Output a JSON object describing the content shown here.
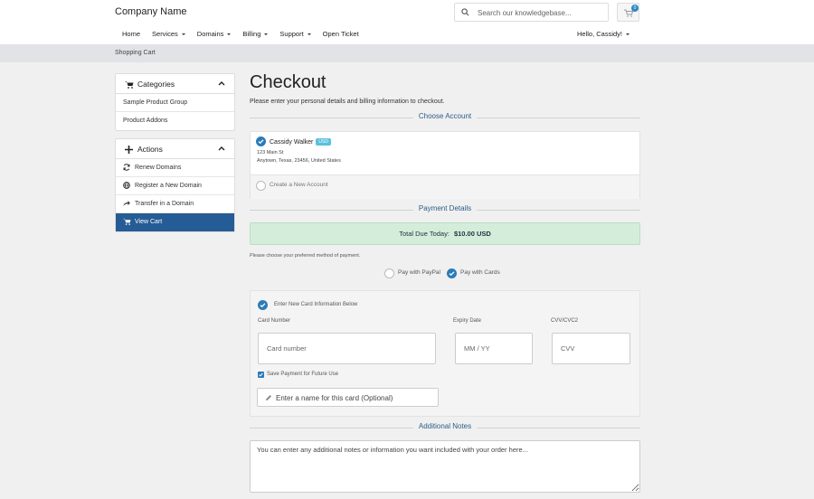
{
  "header": {
    "brand": "Company Name",
    "search_placeholder": "Search our knowledgebase...",
    "cart_count": "0",
    "greeting": "Hello, Cassidy!"
  },
  "nav": [
    {
      "label": "Home",
      "dropdown": false
    },
    {
      "label": "Services",
      "dropdown": true
    },
    {
      "label": "Domains",
      "dropdown": true
    },
    {
      "label": "Billing",
      "dropdown": true
    },
    {
      "label": "Support",
      "dropdown": true
    },
    {
      "label": "Open Ticket",
      "dropdown": false
    }
  ],
  "breadcrumb": "Shopping Cart",
  "sidebar": {
    "categories": {
      "title": "Categories",
      "items": [
        "Sample Product Group",
        "Product Addons"
      ]
    },
    "actions": {
      "title": "Actions",
      "items": [
        {
          "label": "Renew Domains",
          "icon": "refresh-icon"
        },
        {
          "label": "Register a New Domain",
          "icon": "globe-icon"
        },
        {
          "label": "Transfer in a Domain",
          "icon": "share-arrow-icon"
        },
        {
          "label": "View Cart",
          "icon": "cart-icon",
          "active": true
        }
      ]
    }
  },
  "main": {
    "title": "Checkout",
    "subtitle": "Please enter your personal details and billing information to checkout.",
    "choose_account": "Choose Account",
    "account": {
      "name": "Cassidy Walker",
      "currency": "USD",
      "address1": "123 Main St",
      "address2": "Anytown, Texas, 23456, United States"
    },
    "create_new": "Create a New Account",
    "payment_details": "Payment Details",
    "total_label": "Total Due Today:",
    "total_value": "$10.00 USD",
    "method_prompt": "Please choose your preferred method of payment.",
    "pay_paypal": "Pay with PayPal",
    "pay_cards": "Pay with Cards",
    "card": {
      "enter_new": "Enter New Card Information Below",
      "number_label": "Card Number",
      "number_placeholder": "Card number",
      "expiry_label": "Expiry Date",
      "expiry_placeholder": "MM / YY",
      "cvv_label": "CVV/CVC2",
      "cvv_placeholder": "CVV",
      "save_label": "Save Payment for Future Use",
      "name_placeholder": "Enter a name for this card (Optional)"
    },
    "additional_notes": "Additional Notes",
    "notes_placeholder": "You can enter any additional notes or information you want included with your order here..."
  },
  "colors": {
    "accent": "#265c95",
    "check": "#2b7bb9",
    "success_bg": "#d4edda"
  }
}
